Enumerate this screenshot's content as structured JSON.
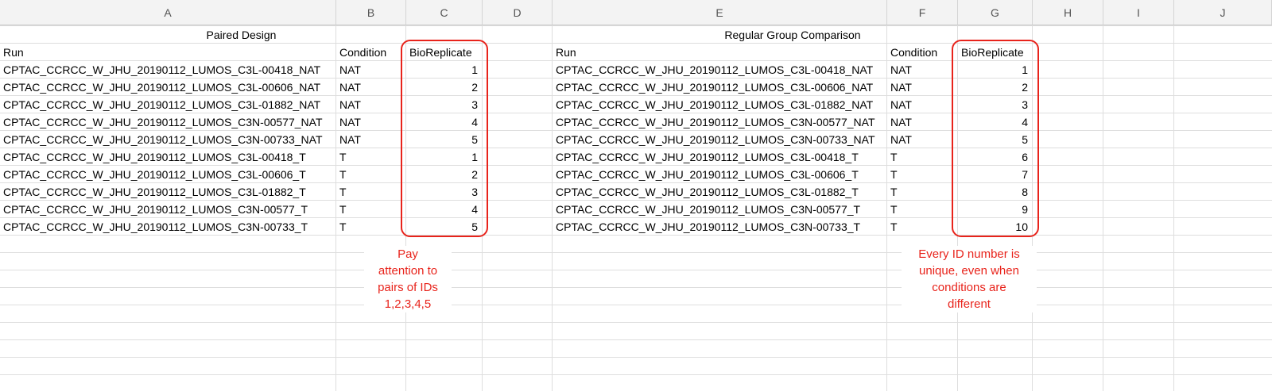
{
  "columns": [
    "A",
    "B",
    "C",
    "D",
    "E",
    "F",
    "G",
    "H",
    "I",
    "J"
  ],
  "left_table": {
    "title": "Paired Design",
    "headers": [
      "Run",
      "Condition",
      "BioReplicate"
    ],
    "rows": [
      [
        "CPTAC_CCRCC_W_JHU_20190112_LUMOS_C3L-00418_NAT",
        "NAT",
        "1"
      ],
      [
        "CPTAC_CCRCC_W_JHU_20190112_LUMOS_C3L-00606_NAT",
        "NAT",
        "2"
      ],
      [
        "CPTAC_CCRCC_W_JHU_20190112_LUMOS_C3L-01882_NAT",
        "NAT",
        "3"
      ],
      [
        "CPTAC_CCRCC_W_JHU_20190112_LUMOS_C3N-00577_NAT",
        "NAT",
        "4"
      ],
      [
        "CPTAC_CCRCC_W_JHU_20190112_LUMOS_C3N-00733_NAT",
        "NAT",
        "5"
      ],
      [
        "CPTAC_CCRCC_W_JHU_20190112_LUMOS_C3L-00418_T",
        "T",
        "1"
      ],
      [
        "CPTAC_CCRCC_W_JHU_20190112_LUMOS_C3L-00606_T",
        "T",
        "2"
      ],
      [
        "CPTAC_CCRCC_W_JHU_20190112_LUMOS_C3L-01882_T",
        "T",
        "3"
      ],
      [
        "CPTAC_CCRCC_W_JHU_20190112_LUMOS_C3N-00577_T",
        "T",
        "4"
      ],
      [
        "CPTAC_CCRCC_W_JHU_20190112_LUMOS_C3N-00733_T",
        "T",
        "5"
      ]
    ],
    "note": [
      "Pay",
      "attention to",
      "pairs of IDs",
      "1,2,3,4,5"
    ]
  },
  "right_table": {
    "title": "Regular Group Comparison",
    "headers": [
      "Run",
      "Condition",
      "BioReplicate"
    ],
    "rows": [
      [
        "CPTAC_CCRCC_W_JHU_20190112_LUMOS_C3L-00418_NAT",
        "NAT",
        "1"
      ],
      [
        "CPTAC_CCRCC_W_JHU_20190112_LUMOS_C3L-00606_NAT",
        "NAT",
        "2"
      ],
      [
        "CPTAC_CCRCC_W_JHU_20190112_LUMOS_C3L-01882_NAT",
        "NAT",
        "3"
      ],
      [
        "CPTAC_CCRCC_W_JHU_20190112_LUMOS_C3N-00577_NAT",
        "NAT",
        "4"
      ],
      [
        "CPTAC_CCRCC_W_JHU_20190112_LUMOS_C3N-00733_NAT",
        "NAT",
        "5"
      ],
      [
        "CPTAC_CCRCC_W_JHU_20190112_LUMOS_C3L-00418_T",
        "T",
        "6"
      ],
      [
        "CPTAC_CCRCC_W_JHU_20190112_LUMOS_C3L-00606_T",
        "T",
        "7"
      ],
      [
        "CPTAC_CCRCC_W_JHU_20190112_LUMOS_C3L-01882_T",
        "T",
        "8"
      ],
      [
        "CPTAC_CCRCC_W_JHU_20190112_LUMOS_C3N-00577_T",
        "T",
        "9"
      ],
      [
        "CPTAC_CCRCC_W_JHU_20190112_LUMOS_C3N-00733_T",
        "T",
        "10"
      ]
    ],
    "note": [
      "Every ID number is",
      "unique, even when",
      "conditions are",
      "different"
    ]
  },
  "colors": {
    "annotation": "#e8231b",
    "header_bg": "#f3f3f3",
    "gridline": "#dedede"
  }
}
